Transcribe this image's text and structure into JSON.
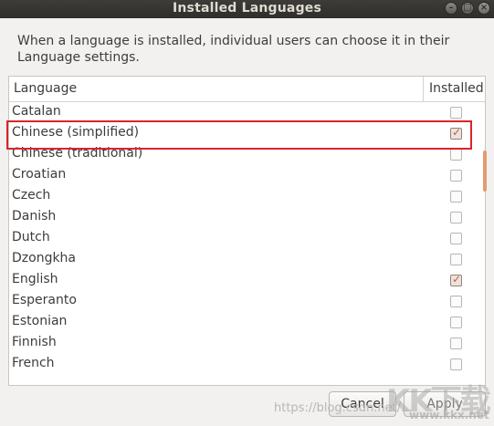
{
  "window": {
    "title": "Installed Languages",
    "controls": [
      "minimize-icon",
      "maximize-icon",
      "close-icon"
    ]
  },
  "description": "When a language is installed, individual users can choose it in their Language settings.",
  "table": {
    "columns": [
      "Language",
      "Installed"
    ],
    "rows": [
      {
        "language": "Catalan",
        "installed": false
      },
      {
        "language": "Chinese (simplified)",
        "installed": true
      },
      {
        "language": "Chinese (traditional)",
        "installed": false
      },
      {
        "language": "Croatian",
        "installed": false
      },
      {
        "language": "Czech",
        "installed": false
      },
      {
        "language": "Danish",
        "installed": false
      },
      {
        "language": "Dutch",
        "installed": false
      },
      {
        "language": "Dzongkha",
        "installed": false
      },
      {
        "language": "English",
        "installed": true
      },
      {
        "language": "Esperanto",
        "installed": false
      },
      {
        "language": "Estonian",
        "installed": false
      },
      {
        "language": "Finnish",
        "installed": false
      },
      {
        "language": "French",
        "installed": false
      }
    ]
  },
  "buttons": {
    "cancel": "Cancel",
    "apply": "Apply"
  },
  "watermark": {
    "url": "https://blog.csdn.net/...",
    "logo": "KK下载",
    "logo_sub": "www.kkx.net"
  },
  "colors": {
    "accent": "#e59a71",
    "check": "#d35a2a",
    "highlight": "#d8262a",
    "titlebar": "#3d3c38"
  }
}
